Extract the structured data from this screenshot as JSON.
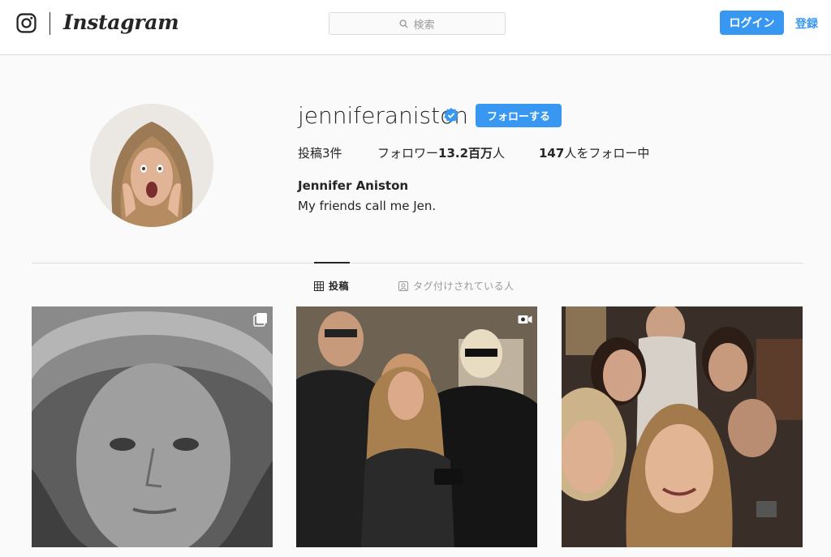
{
  "header": {
    "brand": "Instagram",
    "search_placeholder": "検索",
    "login_label": "ログイン",
    "signup_label": "登録"
  },
  "profile": {
    "username": "jenniferaniston",
    "follow_label": "フォローする",
    "posts_stat": "投稿3件",
    "followers_prefix": "フォロワー",
    "followers_count": "13.2百万",
    "followers_suffix": "人",
    "following_count": "147",
    "following_suffix": "人をフォロー中",
    "full_name": "Jennifer Aniston",
    "bio": "My friends call me Jen."
  },
  "tabs": {
    "posts_label": "投稿",
    "tagged_label": "タグ付けされている人"
  },
  "posts": [
    {
      "badge": "carousel-icon"
    },
    {
      "badge": "video-icon"
    },
    {
      "badge": ""
    }
  ],
  "colors": {
    "accent": "#3897f0",
    "text": "#262626",
    "muted": "#999999",
    "border": "#dbdbdb",
    "background": "#fafafa"
  }
}
